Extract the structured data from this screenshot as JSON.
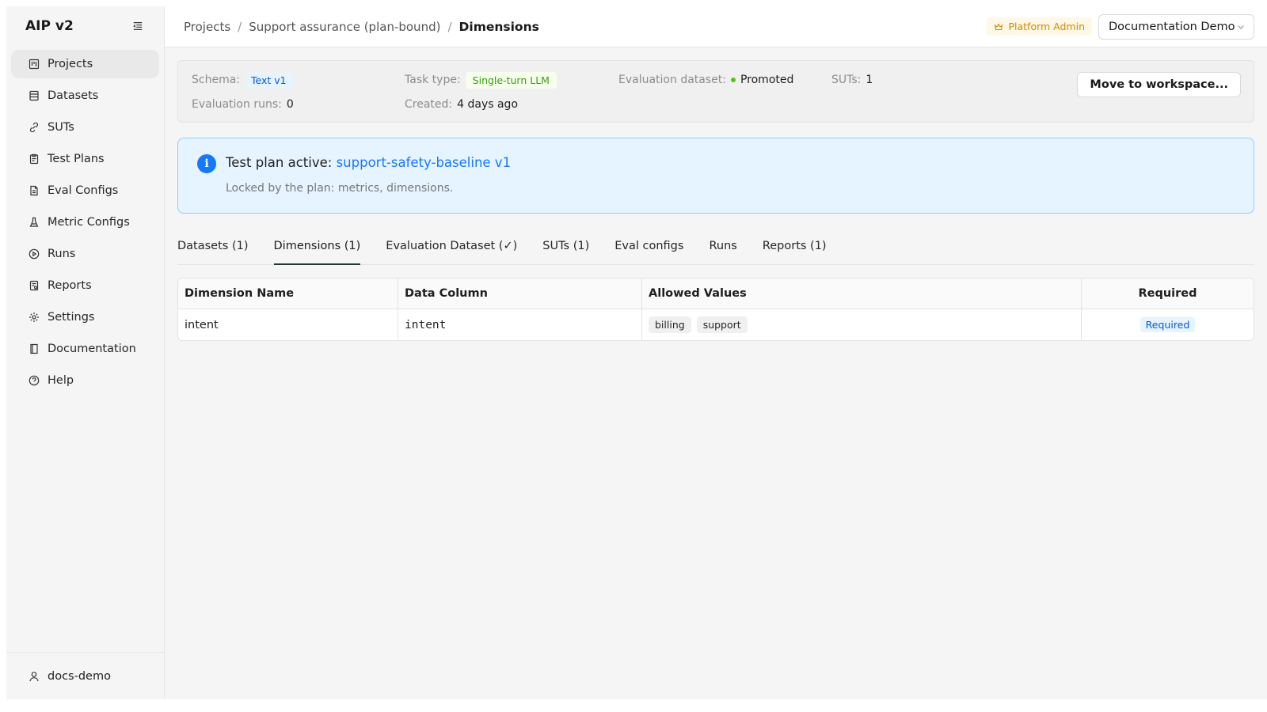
{
  "app": {
    "title": "AIP v2"
  },
  "sidebar": {
    "items": [
      {
        "label": "Projects",
        "icon": "board-icon",
        "active": true
      },
      {
        "label": "Datasets",
        "icon": "database-icon"
      },
      {
        "label": "SUTs",
        "icon": "link-icon"
      },
      {
        "label": "Test Plans",
        "icon": "clipboard-icon"
      },
      {
        "label": "Eval Configs",
        "icon": "file-icon"
      },
      {
        "label": "Metric Configs",
        "icon": "flask-icon"
      },
      {
        "label": "Runs",
        "icon": "play-circle-icon"
      },
      {
        "label": "Reports",
        "icon": "report-icon"
      },
      {
        "label": "Settings",
        "icon": "gear-icon"
      },
      {
        "label": "Documentation",
        "icon": "book-icon"
      },
      {
        "label": "Help",
        "icon": "help-icon"
      }
    ],
    "user": "docs-demo"
  },
  "header": {
    "breadcrumb": [
      "Projects",
      "Support assurance (plan-bound)",
      "Dimensions"
    ],
    "admin_badge": "Platform Admin",
    "workspace": "Documentation Demo"
  },
  "summary": {
    "schema_label": "Schema",
    "schema_value": "Text v1",
    "task_type_label": "Task type",
    "task_type_value": "Single-turn LLM",
    "eval_dataset_label": "Evaluation dataset",
    "eval_dataset_value": "Promoted",
    "suts_label": "SUTs",
    "suts_value": "1",
    "eval_runs_label": "Evaluation runs",
    "eval_runs_value": "0",
    "created_label": "Created",
    "created_value": "4 days ago",
    "move_button": "Move to workspace..."
  },
  "alert": {
    "title": "Test plan active:",
    "link": "support-safety-baseline v1",
    "description": "Locked by the plan: metrics, dimensions."
  },
  "tabs": [
    {
      "label": "Datasets (1)"
    },
    {
      "label": "Dimensions (1)",
      "active": true
    },
    {
      "label": "Evaluation Dataset (✓)"
    },
    {
      "label": "SUTs (1)"
    },
    {
      "label": "Eval configs"
    },
    {
      "label": "Runs"
    },
    {
      "label": "Reports (1)"
    }
  ],
  "table": {
    "columns": [
      "Dimension Name",
      "Data Column",
      "Allowed Values",
      "Required"
    ],
    "rows": [
      {
        "name": "intent",
        "column": "intent",
        "values": [
          "billing",
          "support"
        ],
        "required": "Required"
      }
    ]
  }
}
